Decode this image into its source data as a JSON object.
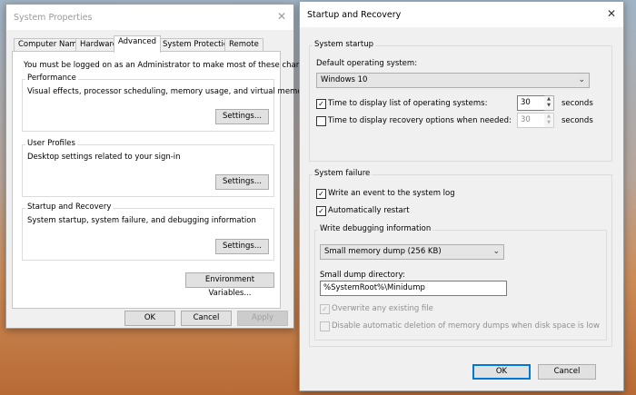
{
  "sysprops": {
    "title": "System Properties",
    "close_icon": "✕",
    "tabs": [
      "Computer Name",
      "Hardware",
      "Advanced",
      "System Protection",
      "Remote"
    ],
    "admin_note": "You must be logged on as an Administrator to make most of these changes.",
    "performance": {
      "label": "Performance",
      "desc": "Visual effects, processor scheduling, memory usage, and virtual memory",
      "button": "Settings..."
    },
    "profiles": {
      "label": "User Profiles",
      "desc": "Desktop settings related to your sign-in",
      "button": "Settings..."
    },
    "startup": {
      "label": "Startup and Recovery",
      "desc": "System startup, system failure, and debugging information",
      "button": "Settings..."
    },
    "env_button": "Environment Variables...",
    "ok": "OK",
    "cancel": "Cancel",
    "apply": "Apply"
  },
  "sr": {
    "title": "Startup and Recovery",
    "close_icon": "✕",
    "startup_group": "System startup",
    "default_os_label": "Default operating system:",
    "default_os": "Windows 10",
    "os_list_label": "Time to display list of operating systems:",
    "os_list_value": "30",
    "os_list_checked": true,
    "recovery_label": "Time to display recovery options when needed:",
    "recovery_value": "30",
    "recovery_checked": false,
    "seconds1": "seconds",
    "seconds2": "seconds",
    "failure_group": "System failure",
    "write_event": "Write an event to the system log",
    "auto_restart": "Automatically restart",
    "debug_group": "Write debugging information",
    "dump_type": "Small memory dump (256 KB)",
    "dump_dir_label": "Small dump directory:",
    "dump_dir": "%SystemRoot%\\Minidump",
    "overwrite": "Overwrite any existing file",
    "disable_auto_delete": "Disable automatic deletion of memory dumps when disk space is low",
    "ok": "OK",
    "cancel": "Cancel",
    "check_glyph": "✓",
    "up_glyph": "▲",
    "down_glyph": "▼",
    "dropdown_glyph": "⌄"
  }
}
